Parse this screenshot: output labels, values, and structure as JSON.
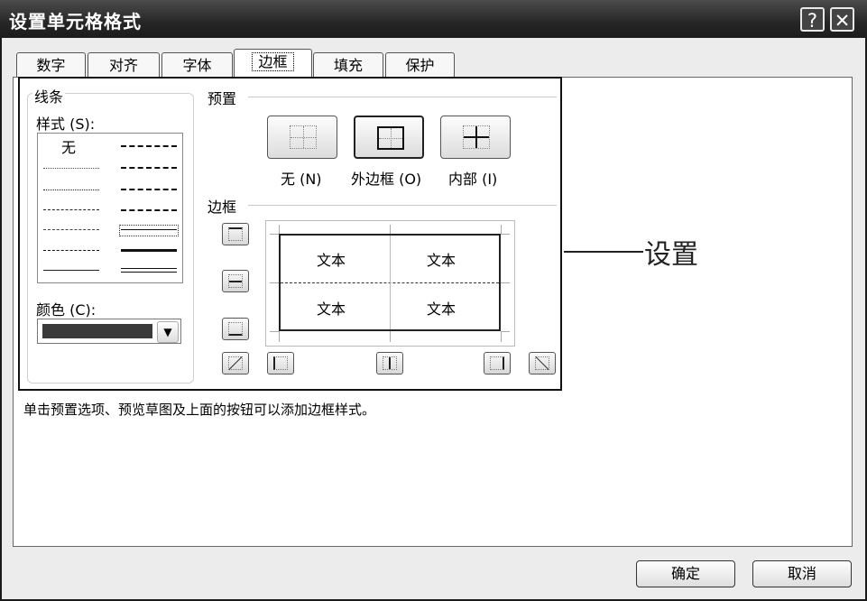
{
  "window": {
    "title": "设置单元格格式",
    "help_label": "?",
    "close_label": "✕"
  },
  "tabs": [
    {
      "label": "数字"
    },
    {
      "label": "对齐"
    },
    {
      "label": "字体"
    },
    {
      "label": "边框",
      "active": true
    },
    {
      "label": "填充"
    },
    {
      "label": "保护"
    }
  ],
  "line": {
    "group_label": "线条",
    "style_label": "样式 (S):",
    "none_label": "无",
    "color_label": "颜色 (C):",
    "color_value": "#3a3a3a"
  },
  "presets": {
    "group_label": "预置",
    "items": [
      {
        "label": "无 (N)"
      },
      {
        "label": "外边框 (O)"
      },
      {
        "label": "内部 (I)"
      }
    ]
  },
  "border": {
    "group_label": "边框",
    "cell_text": "文本"
  },
  "hint": "单击预置选项、预览草图及上面的按钮可以添加边框样式。",
  "buttons": {
    "ok": "确定",
    "cancel": "取消"
  },
  "annotation": "设置"
}
